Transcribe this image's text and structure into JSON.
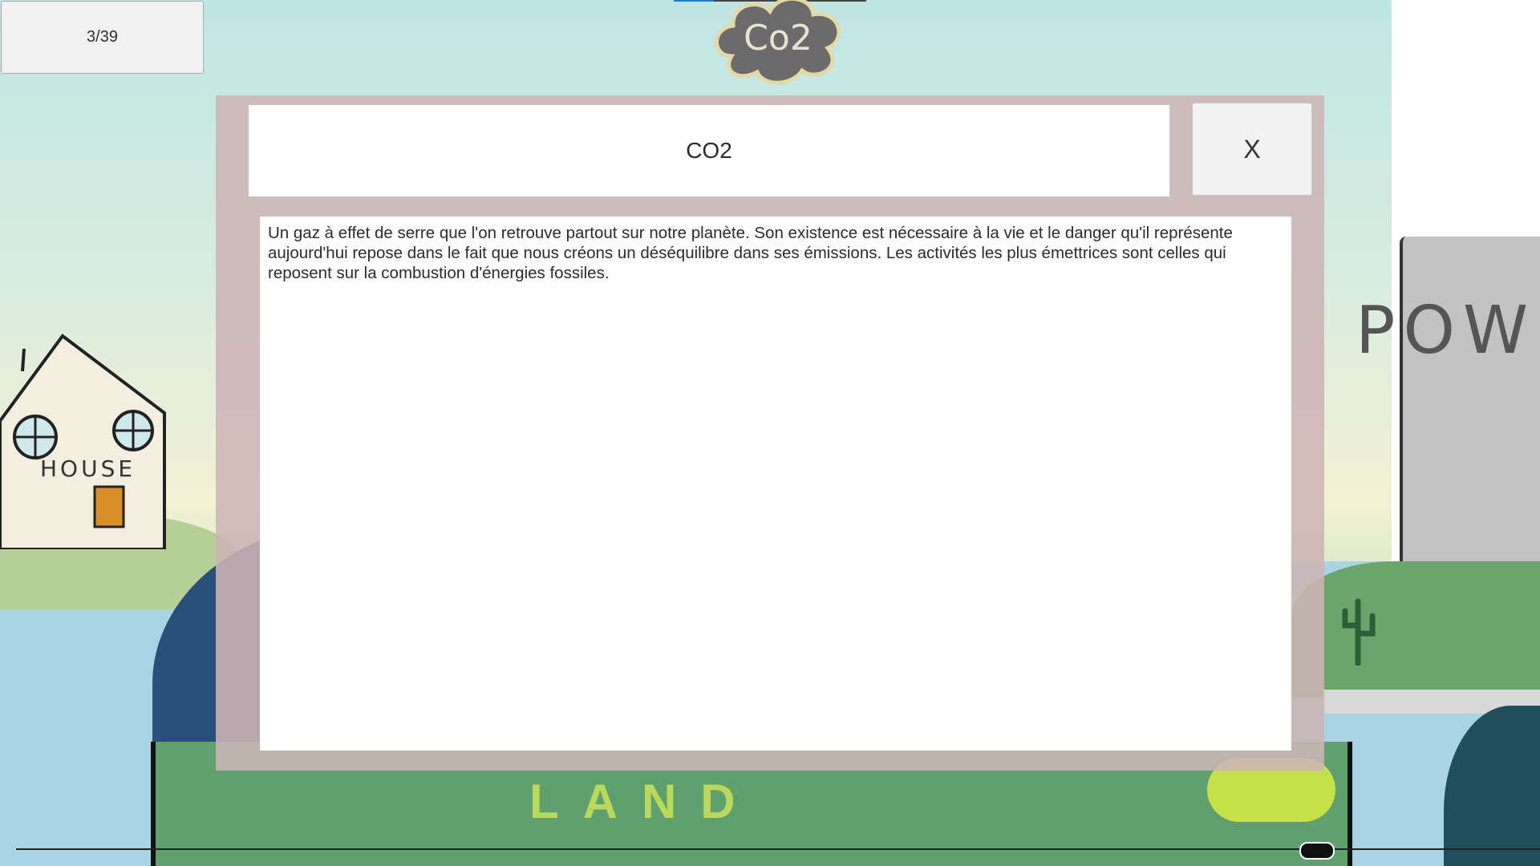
{
  "hud": {
    "progress_counter": "3/39"
  },
  "scene": {
    "house_label": "HOUSE",
    "land_label": "LAND",
    "power_label": "POW",
    "cloud_label": "Co2"
  },
  "info_popup": {
    "title": "CO2",
    "close_label": "X",
    "description": "Un gaz à effet de serre que l'on retrouve partout sur notre planète. Son existence est nécessaire à la vie et le danger qu'il représente aujourd'hui repose dans le fait que nous créons un déséquilibre dans ses émissions. Les activités les plus émettrices sont celles qui reposent sur la combustion d'énergies fossiles."
  },
  "colors": {
    "popup_overlay": "#ccb5b5",
    "panel_white": "#ffffff",
    "button_grey": "#f2f2f2",
    "land_green": "#5fa06e"
  },
  "icons": [
    "co2-cloud-icon",
    "cactus-icon"
  ]
}
